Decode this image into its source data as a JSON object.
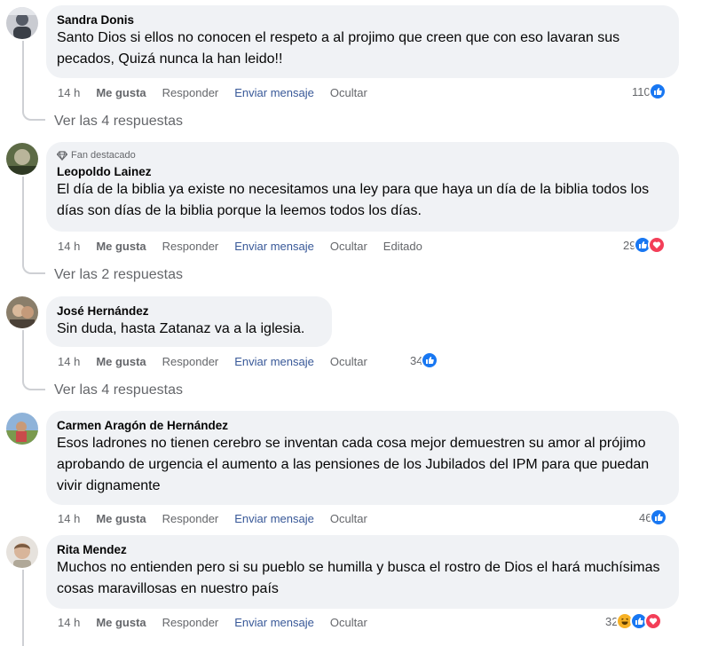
{
  "comments": [
    {
      "author": "Sandra Donis",
      "badge": "",
      "text": "Santo Dios si ellos no conocen el respeto a al projimo que creen que con eso lavaran sus pecados, Quizá nunca la han leido!!",
      "time": "14 h",
      "like": "Me gusta",
      "reply": "Responder",
      "message": "Enviar mensaje",
      "hide": "Ocultar",
      "edited": "",
      "reaction_count": "110",
      "reactions": [
        "like"
      ],
      "replies": "Ver las 4 respuestas"
    },
    {
      "author": "Leopoldo Lainez",
      "badge": "Fan destacado",
      "text": "El día de la biblia ya existe no necesitamos una ley para que haya un día de la biblia todos los días son días de la biblia porque la leemos todos los días.",
      "time": "14 h",
      "like": "Me gusta",
      "reply": "Responder",
      "message": "Enviar mensaje",
      "hide": "Ocultar",
      "edited": "Editado",
      "reaction_count": "29",
      "reactions": [
        "like",
        "love"
      ],
      "replies": "Ver las 2 respuestas"
    },
    {
      "author": "José Hernández",
      "badge": "",
      "text": "Sin duda, hasta Zatanaz va a la iglesia.",
      "time": "14 h",
      "like": "Me gusta",
      "reply": "Responder",
      "message": "Enviar mensaje",
      "hide": "Ocultar",
      "edited": "",
      "reaction_count": "34",
      "reactions": [
        "like"
      ],
      "replies": "Ver las 4 respuestas"
    },
    {
      "author": "Carmen Aragón de Hernández",
      "badge": "",
      "text": "Esos ladrones no tienen cerebro se inventan cada cosa mejor demuestren su amor al prójimo aprobando de urgencia el aumento a las pensiones de los Jubilados del IPM para que puedan vivir dignamente",
      "time": "14 h",
      "like": "Me gusta",
      "reply": "Responder",
      "message": "Enviar mensaje",
      "hide": "Ocultar",
      "edited": "",
      "reaction_count": "46",
      "reactions": [
        "like"
      ],
      "replies": ""
    },
    {
      "author": "Rita Mendez",
      "badge": "",
      "text": "Muchos no entienden pero si su pueblo se humilla y busca el rostro de Dios el hará muchísimas cosas maravillosas en nuestro país",
      "time": "14 h",
      "like": "Me gusta",
      "reply": "Responder",
      "message": "Enviar mensaje",
      "hide": "Ocultar",
      "edited": "",
      "reaction_count": "32",
      "reactions": [
        "haha",
        "like",
        "love"
      ],
      "replies": ""
    }
  ],
  "colors": {
    "bubble": "#f0f2f5",
    "meta": "#65676b",
    "message_link": "#385898",
    "like": "#1877f2",
    "love": "#f33e58",
    "haha": "#f7b125"
  }
}
